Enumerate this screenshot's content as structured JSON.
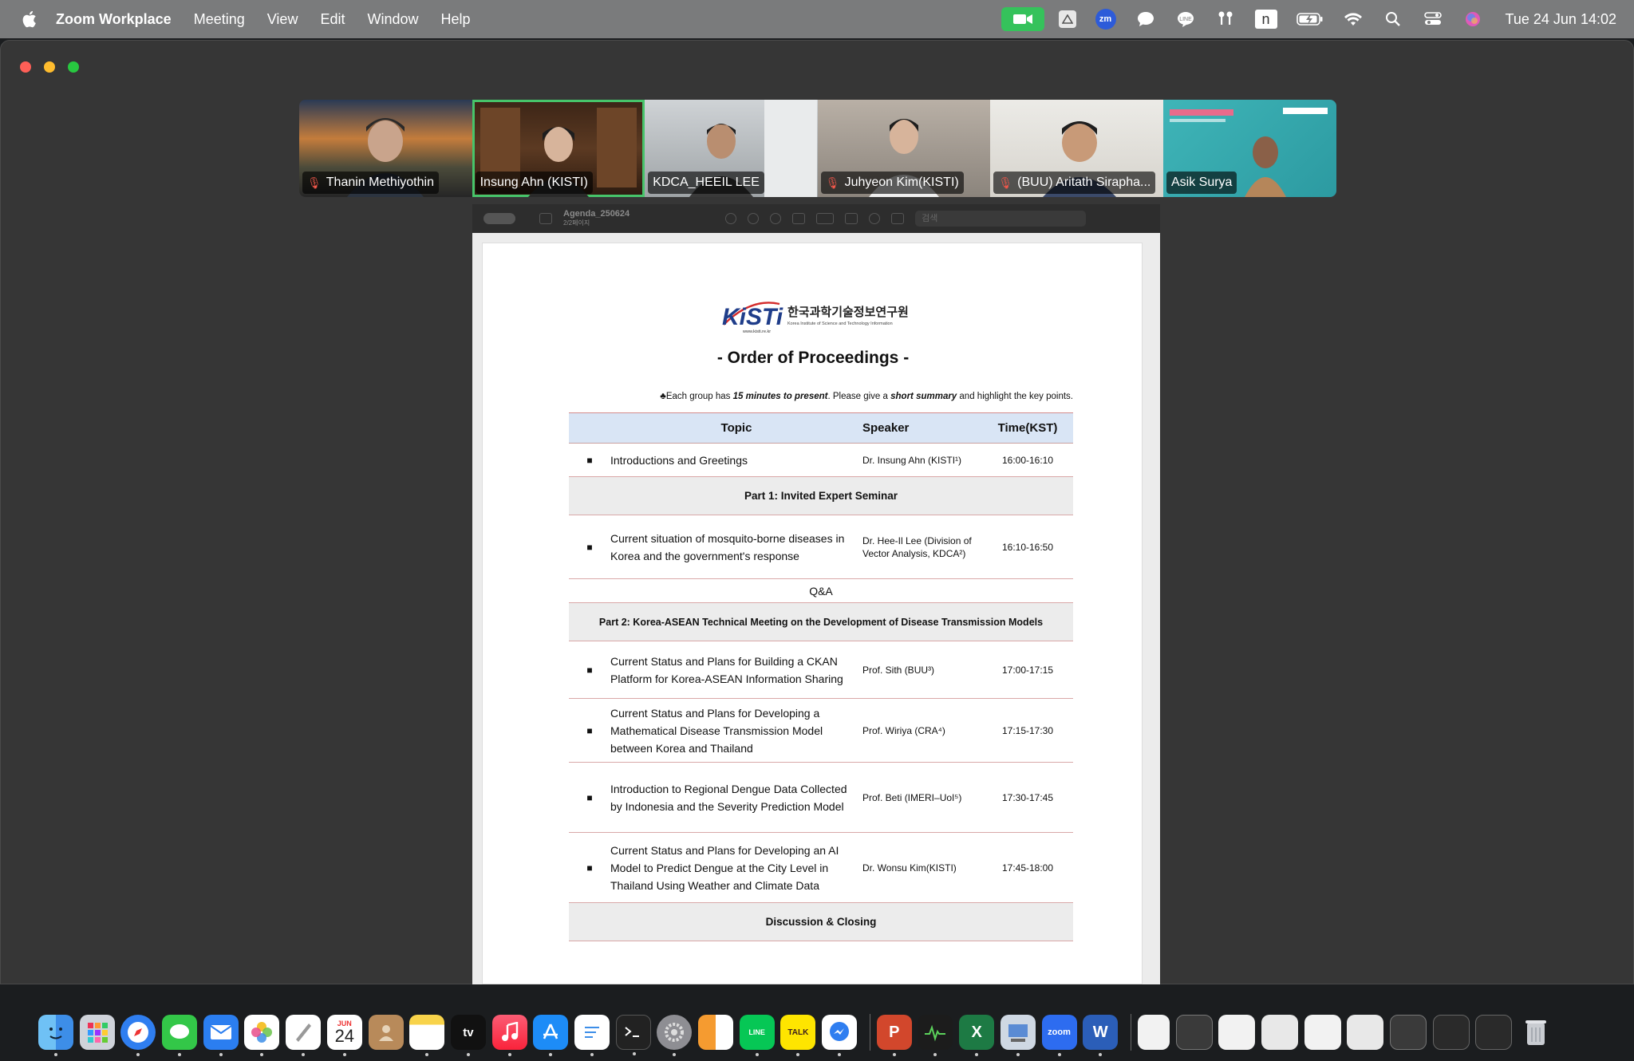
{
  "menubar": {
    "app_name": "Zoom Workplace",
    "menus": [
      "Meeting",
      "View",
      "Edit",
      "Window",
      "Help"
    ],
    "status_icons": [
      "zoom-video-icon",
      "drive-icon",
      "zm-icon",
      "chat-bubble-icon",
      "line-icon",
      "airpods-icon",
      "notion-icon",
      "battery-icon",
      "wifi-icon",
      "spotlight-search-icon",
      "control-center-icon",
      "siri-icon"
    ],
    "zm_label": "zm",
    "notion_label": "n",
    "clock": "Tue 24 Jun  14:02"
  },
  "participants": [
    {
      "name": "Thanin Methiyothin",
      "muted": true,
      "active": false
    },
    {
      "name": "Insung Ahn (KISTI)",
      "muted": false,
      "active": true
    },
    {
      "name": "KDCA_HEEIL LEE",
      "muted": false,
      "active": false
    },
    {
      "name": "Juhyeon Kim(KISTI)",
      "muted": true,
      "active": false
    },
    {
      "name": "(BUU) Aritath Siraphа...",
      "muted": true,
      "active": false
    },
    {
      "name": "Asik Surya",
      "muted": false,
      "active": false
    }
  ],
  "viewer": {
    "file_title": "Agenda_250624",
    "file_subtitle": "2/2페이지",
    "search_placeholder": "검색"
  },
  "document": {
    "logo_brand": "KiSTi",
    "logo_korean": "한국과학기술정보연구원",
    "logo_english": "Korea Institute of Science and Technology Information",
    "logo_url": "www.kisti.re.kr",
    "title": "- Order of Proceedings -",
    "note_prefix": "♣Each group has ",
    "note_bold1": "15 minutes to present",
    "note_mid": ". Please give a ",
    "note_bold2": "short summary",
    "note_suffix": " and highlight the key points.",
    "headers": {
      "topic": "Topic",
      "speaker": "Speaker",
      "time": "Time(KST)"
    },
    "bullet": "■",
    "row1": {
      "topic": "Introductions and Greetings",
      "speaker": "Dr. Insung Ahn (KISTI¹)",
      "time": "16:00-16:10"
    },
    "part1": "Part 1: Invited Expert Seminar",
    "row2": {
      "topic": "Current situation of mosquito-borne diseases in Korea and the government's response",
      "speaker": "Dr. Hee-Il Lee (Division of Vector Analysis, KDCA²)",
      "time": "16:10-16:50"
    },
    "qa": "Q&A",
    "part2": "Part 2: Korea-ASEAN Technical Meeting on the Development of Disease Transmission Models",
    "row3": {
      "topic": "Current Status and Plans for Building a CKAN Platform for Korea-ASEAN Information Sharing",
      "speaker": "Prof. Sith (BUU³)",
      "time": "17:00-17:15"
    },
    "row4": {
      "topic": "Current Status and Plans for Developing a Mathematical Disease Transmission Model between Korea and Thailand",
      "speaker": "Prof. Wiriya (CRA⁴)",
      "time": "17:15-17:30"
    },
    "row5": {
      "topic": "Introduction to Regional Dengue Data Collected by Indonesia and the Severity Prediction Model",
      "speaker": "Prof. Beti (IMERI–UoI⁵)",
      "time": "17:30-17:45"
    },
    "row6": {
      "topic": "Current Status and Plans for Developing an AI Model to Predict Dengue at the City Level in Thailand Using Weather and Climate Data",
      "speaker": "Dr. Wonsu Kim(KISTI)",
      "time": "17:45-18:00"
    },
    "closing": "Discussion & Closing"
  },
  "dock": {
    "apps": [
      "finder-icon",
      "launchpad-icon",
      "safari-icon",
      "messages-icon",
      "mail-icon",
      "photos-icon",
      "freeform-icon",
      "calendar-icon",
      "contacts-icon",
      "notes-icon",
      "apple-tv-icon",
      "music-icon",
      "app-store-icon",
      "textedit-icon",
      "terminal-icon",
      "system-settings-icon",
      "pages-icon",
      "line-app-icon",
      "kakaotalk-icon",
      "messenger-icon",
      "powerpoint-icon",
      "activity-monitor-icon",
      "excel-icon",
      "preview-icon",
      "zoom-app-icon",
      "word-icon"
    ],
    "calendar_month": "JUN",
    "calendar_day": "24",
    "tv_label": "tv",
    "line_label": "LINE",
    "talk_label": "TALK",
    "zoom_label": "zoom",
    "ppt_label": "P",
    "excel_label": "X",
    "word_label": "W"
  }
}
